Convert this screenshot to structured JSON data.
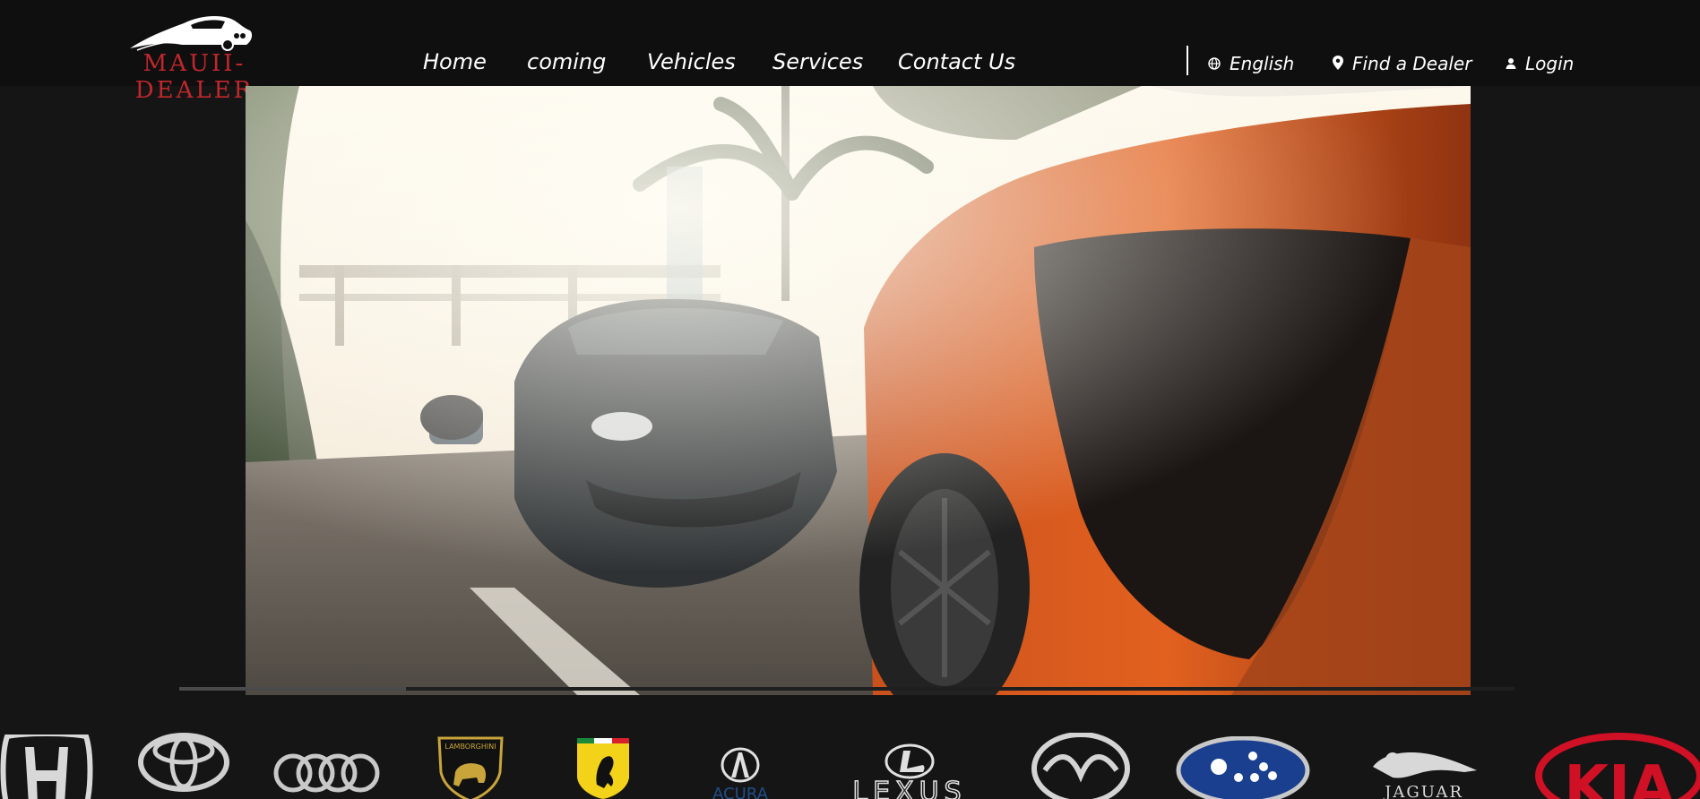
{
  "brand": {
    "name": "MAUII-DEALER",
    "accent_color": "#c0272d"
  },
  "nav": {
    "items": [
      {
        "label": "Home"
      },
      {
        "label": "coming"
      },
      {
        "label": "Vehicles"
      },
      {
        "label": "Services"
      },
      {
        "label": "Contact Us"
      }
    ]
  },
  "utility": {
    "language": {
      "label": "English",
      "icon": "globe-icon"
    },
    "dealer": {
      "label": "Find a Dealer",
      "icon": "map-pin-icon"
    },
    "login": {
      "label": "Login",
      "icon": "user-icon"
    }
  },
  "hero": {
    "image": "video frame of orange and dark grey sports cars on palm-lined street",
    "progress": 0.17
  },
  "brands": {
    "logos": [
      {
        "name": "honda-logo"
      },
      {
        "name": "toyota-logo"
      },
      {
        "name": "audi-logo"
      },
      {
        "name": "lamborghini-logo",
        "text": "LAMBORGHINI"
      },
      {
        "name": "ferrari-logo"
      },
      {
        "name": "acura-logo",
        "text": "ACURA"
      },
      {
        "name": "lexus-logo",
        "text": "LEXUS"
      },
      {
        "name": "mazda-logo"
      },
      {
        "name": "subaru-logo"
      },
      {
        "name": "jaguar-logo",
        "text": "JAGUAR"
      },
      {
        "name": "kia-logo",
        "text": "KIA"
      }
    ]
  }
}
